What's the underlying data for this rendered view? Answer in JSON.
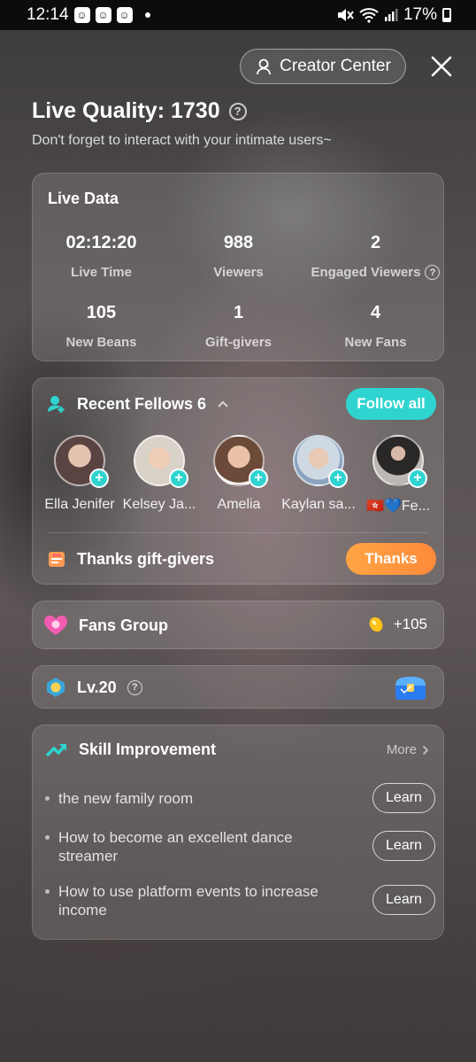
{
  "statusbar": {
    "time": "12:14",
    "battery": "17%"
  },
  "header": {
    "creator_center_label": "Creator Center",
    "title": "Live Quality: 1730",
    "subtitle": "Don't forget to interact with your intimate users~"
  },
  "live_data": {
    "title": "Live Data",
    "stats": [
      {
        "value": "02:12:20",
        "label": "Live Time"
      },
      {
        "value": "988",
        "label": "Viewers"
      },
      {
        "value": "2",
        "label": "Engaged Viewers"
      },
      {
        "value": "105",
        "label": "New Beans"
      },
      {
        "value": "1",
        "label": "Gift-givers"
      },
      {
        "value": "4",
        "label": "New Fans"
      }
    ]
  },
  "fellows": {
    "title": "Recent Fellows 6",
    "follow_all_label": "Follow all",
    "users": [
      {
        "name": "Ella Jenifer",
        "color": "#7a5a55"
      },
      {
        "name": "Kelsey Ja...",
        "color": "#c9b7a9"
      },
      {
        "name": "Amelia",
        "color": "#a57d6a"
      },
      {
        "name": "Kaylan sa...",
        "color": "#8fa4b8"
      },
      {
        "name": "🇭🇰💙Fe...",
        "color": "#3c3737"
      }
    ],
    "thanks_title": "Thanks gift-givers",
    "thanks_label": "Thanks"
  },
  "fans_group": {
    "title": "Fans Group",
    "value": "+105"
  },
  "level": {
    "title": "Lv.20"
  },
  "skill": {
    "title": "Skill Improvement",
    "more_label": "More",
    "tips": [
      {
        "text": "the new family room",
        "action": "Learn"
      },
      {
        "text": "How to become an excellent dance streamer",
        "action": "Learn"
      },
      {
        "text": "How to use platform events to increase income",
        "action": "Learn"
      }
    ]
  },
  "colors": {
    "accent_teal": "#2fd4d0",
    "accent_orange": "#ff9a40"
  }
}
